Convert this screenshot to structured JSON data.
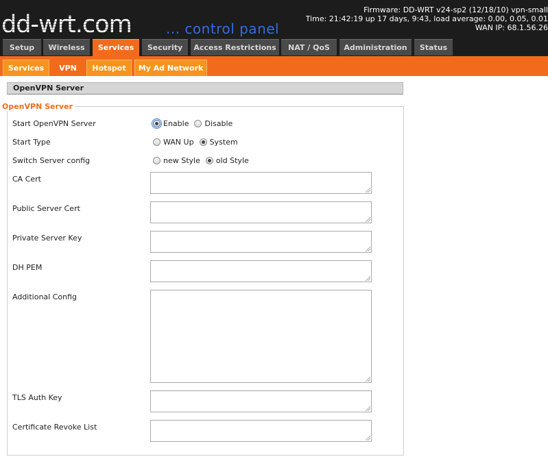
{
  "header": {
    "logo_text": "dd-wrt.com",
    "tagline": "... control panel",
    "firmware": "Firmware: DD-WRT v24-sp2 (12/18/10) vpn-small",
    "time": "Time: 21:42:19 up 17 days, 9:43, load average: 0.00, 0.05, 0.01",
    "wan_ip": "WAN IP: 68.1.56.26"
  },
  "tabs": [
    {
      "label": "Setup",
      "active": false
    },
    {
      "label": "Wireless",
      "active": false
    },
    {
      "label": "Services",
      "active": true
    },
    {
      "label": "Security",
      "active": false
    },
    {
      "label": "Access Restrictions",
      "active": false
    },
    {
      "label": "NAT / QoS",
      "active": false
    },
    {
      "label": "Administration",
      "active": false
    },
    {
      "label": "Status",
      "active": false
    }
  ],
  "subtabs": [
    {
      "label": "Services",
      "active": false
    },
    {
      "label": "VPN",
      "active": true
    },
    {
      "label": "Hotspot",
      "active": false
    },
    {
      "label": "My Ad Network",
      "active": false
    }
  ],
  "section_title": "OpenVPN Server",
  "fieldset_legend": "OpenVPN Server",
  "fields": {
    "start_server": {
      "label": "Start OpenVPN Server",
      "options": [
        "Enable",
        "Disable"
      ],
      "selected": "Enable"
    },
    "start_type": {
      "label": "Start Type",
      "options": [
        "WAN Up",
        "System"
      ],
      "selected": "System"
    },
    "switch_config": {
      "label": "Switch Server config",
      "options": [
        "new Style",
        "old Style"
      ],
      "selected": "old Style"
    },
    "ca_cert": {
      "label": "CA Cert",
      "value": ""
    },
    "public_cert": {
      "label": "Public Server Cert",
      "value": ""
    },
    "private_key": {
      "label": "Private Server Key",
      "value": ""
    },
    "dh_pem": {
      "label": "DH PEM",
      "value": ""
    },
    "additional_config": {
      "label": "Additional Config",
      "value": ""
    },
    "tls_auth_key": {
      "label": "TLS Auth Key",
      "value": ""
    },
    "crl": {
      "label": "Certificate Revoke List",
      "value": ""
    }
  },
  "colors": {
    "header_bg": "#1c1c1c",
    "accent_orange": "#f26b1d",
    "subtab_orange": "#f7941e",
    "tab_gray": "#4a4a4a",
    "tagline_blue": "#2f6fe0"
  }
}
